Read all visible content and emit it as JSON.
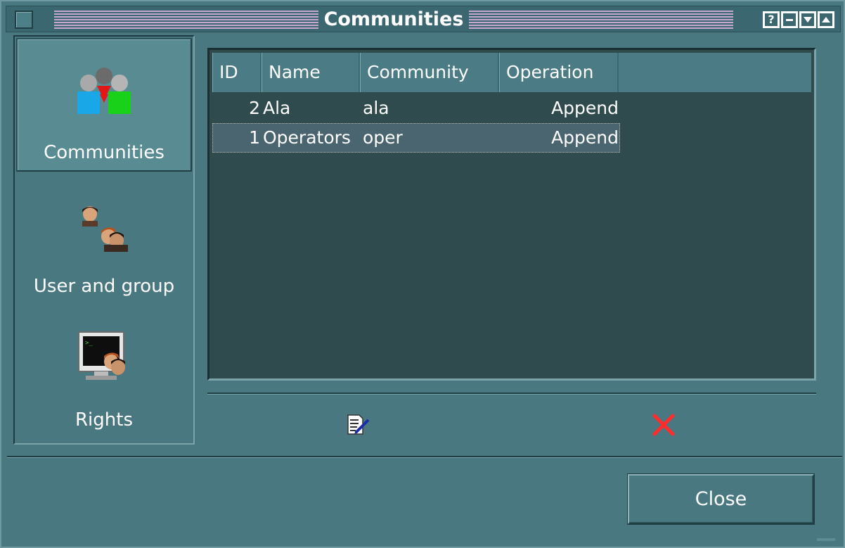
{
  "window": {
    "title": "Communities",
    "titlebar_buttons": [
      "help-icon",
      "minimize-icon",
      "shade-down-icon",
      "maximize-icon"
    ],
    "help_glyph": "?"
  },
  "nav": {
    "items": [
      {
        "label": "Communities",
        "icon": "communities-icon",
        "active": true
      },
      {
        "label": "User and group",
        "icon": "users-groups-icon",
        "active": false
      },
      {
        "label": "Rights",
        "icon": "rights-icon",
        "active": false
      }
    ]
  },
  "table": {
    "columns": [
      "ID",
      "Name",
      "Community",
      "Operation"
    ],
    "rows": [
      {
        "id": "2",
        "name": "Ala",
        "community": "ala",
        "operation": "Append",
        "selected": false
      },
      {
        "id": "1",
        "name": "Operators",
        "community": "oper",
        "operation": "Append",
        "selected": true
      }
    ]
  },
  "actions": {
    "edit_icon": "edit-icon",
    "delete_icon": "delete-icon"
  },
  "footer": {
    "close_label": "Close"
  },
  "colors": {
    "window_bg": "#4a7881",
    "table_bg": "#2f4b4d",
    "selection_bg": "#4a6470",
    "title_stripes": "#c7a7cf",
    "delete_red": "#e02020"
  }
}
